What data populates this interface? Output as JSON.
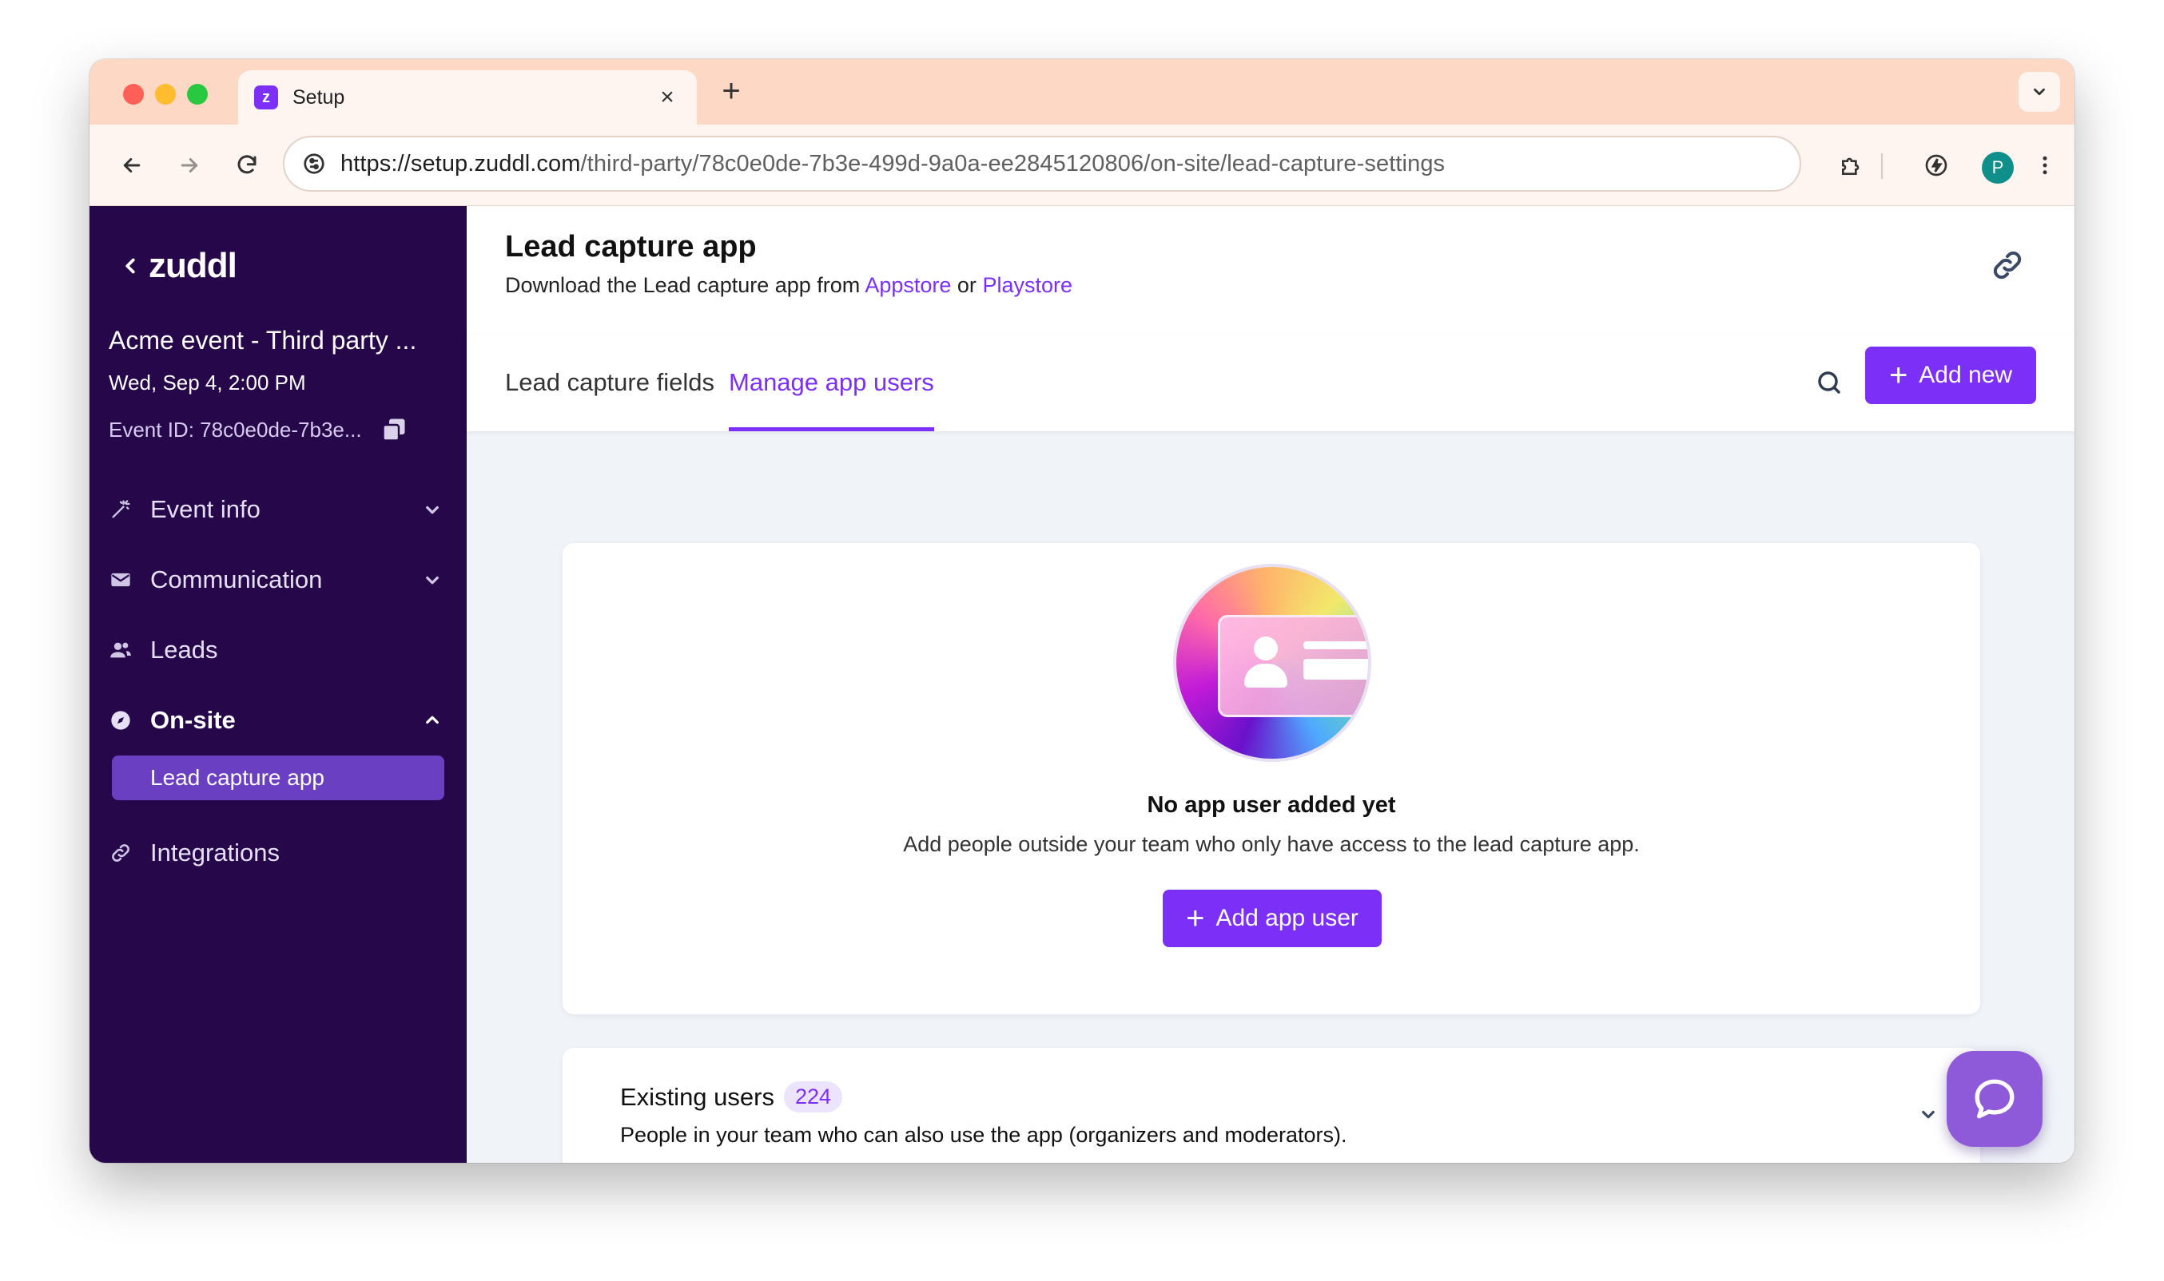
{
  "browser": {
    "tab_title": "Setup",
    "tab_favicon_letter": "z",
    "url_domain": "https://setup.zuddl.com",
    "url_path": "/third-party/78c0e0de-7b3e-499d-9a0a-ee2845120806/on-site/lead-capture-settings",
    "profile_initial": "P"
  },
  "sidebar": {
    "brand": "zuddl",
    "event_name": "Acme event - Third party ...",
    "event_date": "Wed, Sep 4, 2:00 PM",
    "event_id": "Event ID: 78c0e0de-7b3e...",
    "items": [
      {
        "label": "Event info",
        "icon": "magic-wand-icon"
      },
      {
        "label": "Communication",
        "icon": "mail-icon"
      },
      {
        "label": "Leads",
        "icon": "users-icon"
      },
      {
        "label": "On-site",
        "icon": "compass-icon"
      },
      {
        "label": "Integrations",
        "icon": "link-icon"
      }
    ],
    "sub_item": "Lead capture app"
  },
  "header": {
    "title": "Lead capture app",
    "subtitle_prefix": "Download the Lead capture app from",
    "appstore": "Appstore",
    "or": "or",
    "playstore": "Playstore"
  },
  "tabs": [
    {
      "label": "Lead capture fields"
    },
    {
      "label": "Manage app users"
    }
  ],
  "toolbar": {
    "add_new_label": "Add new"
  },
  "empty_state": {
    "title": "No app user added yet",
    "description": "Add people outside your team who only have access to the lead capture app.",
    "button_label": "Add app user"
  },
  "existing": {
    "title": "Existing users",
    "count": "224",
    "description": "People in your team who can also use the app (organizers and moderators)."
  },
  "colors": {
    "accent": "#7b2ff7",
    "sidebar_bg": "#25074a",
    "sidebar_active": "#6b3fc2",
    "tab_strip": "#fdd8c5"
  }
}
